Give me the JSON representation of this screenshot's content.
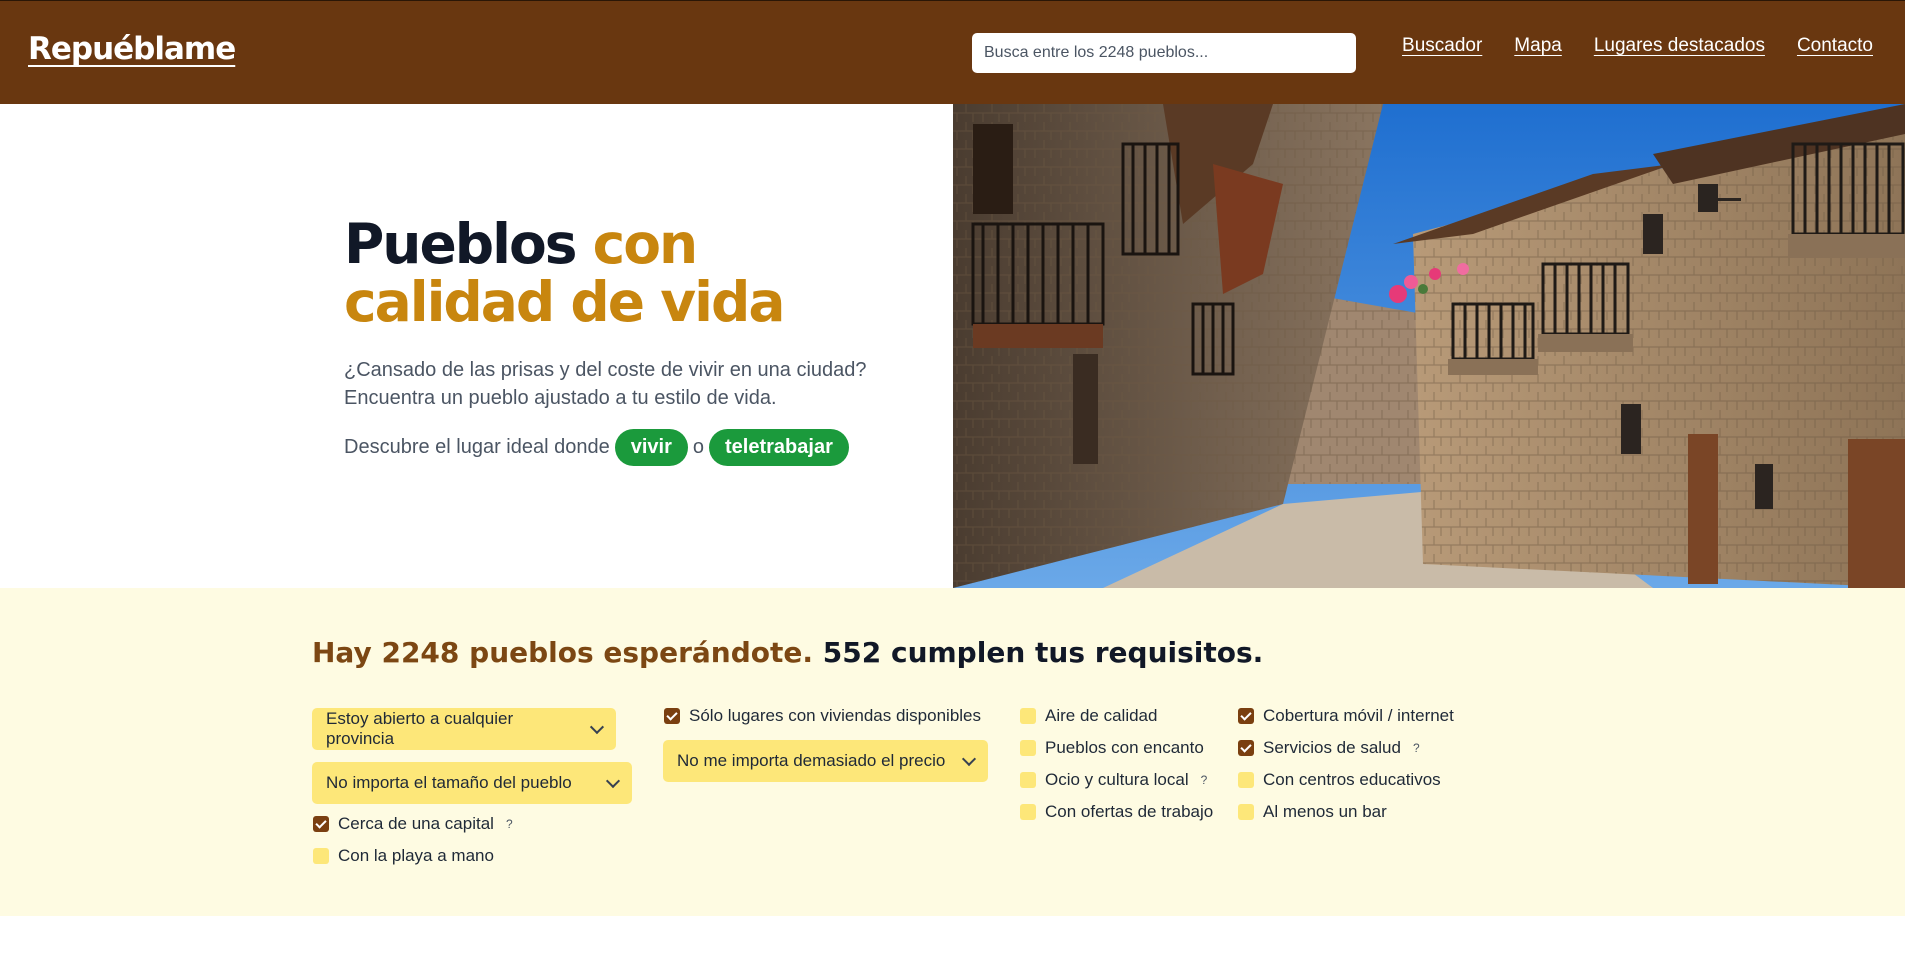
{
  "header": {
    "logo": "Repuéblame",
    "search_placeholder": "Busca entre los 2248 pueblos...",
    "nav": [
      "Buscador",
      "Mapa",
      "Lugares destacados",
      "Contacto"
    ]
  },
  "hero": {
    "title_part1": "Pueblos ",
    "title_part2": "con calidad de vida",
    "subtitle_line1": "¿Cansado de las prisas y del coste de vivir en una ciudad?",
    "subtitle_line2": "Encuentra un pueblo ajustado a tu estilo de vida.",
    "cta_prefix": "Descubre el lugar ideal donde",
    "cta_option1": "vivir",
    "cta_connector": "o",
    "cta_option2": "teletrabajar"
  },
  "filters": {
    "title_part1": "Hay 2248 pueblos esperándote.",
    "title_part2": " 552 cumplen tus requisitos.",
    "selects": {
      "province": "Estoy abierto a cualquier provincia",
      "size": "No importa el tamaño del pueblo",
      "price": "No me importa demasiado el precio"
    },
    "checks": {
      "near_capital": {
        "label": "Cerca de una capital",
        "checked": true,
        "help": "?"
      },
      "beach": {
        "label": "Con la playa a mano",
        "checked": false
      },
      "housing": {
        "label": "Sólo lugares con viviendas disponibles",
        "checked": true
      },
      "air": {
        "label": "Aire de calidad",
        "checked": false
      },
      "charm": {
        "label": "Pueblos con encanto",
        "checked": false
      },
      "culture": {
        "label": "Ocio y cultura local",
        "checked": false,
        "help": "?"
      },
      "jobs": {
        "label": "Con ofertas de trabajo",
        "checked": false
      },
      "coverage": {
        "label": "Cobertura móvil / internet",
        "checked": true
      },
      "health": {
        "label": "Servicios de salud",
        "checked": true,
        "help": "?"
      },
      "schools": {
        "label": "Con centros educativos",
        "checked": false
      },
      "bar": {
        "label": "Al menos un bar",
        "checked": false
      }
    }
  },
  "colors": {
    "header_bg": "#693710",
    "accent_gold": "#c8860f",
    "cta_green": "#1b9a3c",
    "filters_bg": "#fefbe2",
    "select_bg": "#fde779",
    "checkbox_on": "#7a3f10"
  }
}
